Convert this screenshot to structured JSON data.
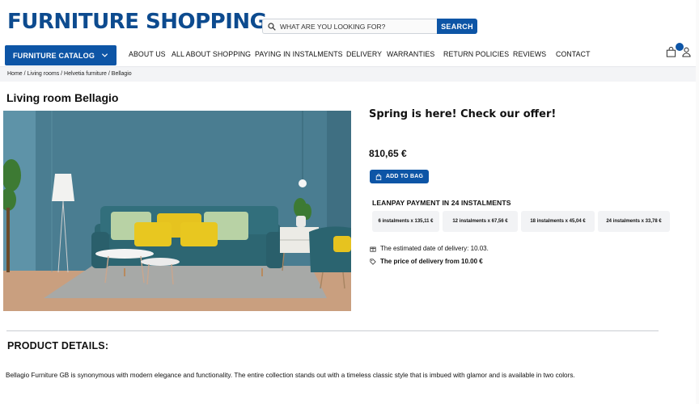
{
  "header": {
    "logo": "FURNITURE SHOPPING",
    "search_placeholder": "WHAT ARE YOU LOOKING FOR?",
    "search_button": "SEARCH"
  },
  "nav": {
    "catalog_label": "FURNITURE CATALOG",
    "items": [
      "ABOUT US",
      "ALL ABOUT SHOPPING",
      "PAYING IN INSTALMENTS",
      "DELIVERY",
      "WARRANTIES",
      "RETURN POLICIES",
      "REVIEWS",
      "CONTACT"
    ]
  },
  "breadcrumb": "Home / Living rooms / Helvetia furniture / Bellagio",
  "product": {
    "title": "Living room Bellagio",
    "promo": "Spring is here! Check our offer!",
    "price": "810,65 €",
    "add_to_bag": "ADD TO BAG",
    "leanpay_title": "LEANPAY PAYMENT IN 24 INSTALMENTS",
    "instalments": [
      "6 instalments x 135,11 €",
      "12 instalments x 67,56 €",
      "18 instalments x 45,04 €",
      "24 instalments x 33,78 €"
    ],
    "delivery_date": "The estimated date of delivery: 10.03.",
    "delivery_price": "The price of delivery from 10.00 €"
  },
  "details": {
    "title": "PRODUCT DETAILS:",
    "description": "Bellagio Furniture GB is synonymous with modern elegance and functionality. The entire collection stands out with a timeless classic style that is imbued with glamor and is available in two colors."
  },
  "colors": {
    "brand": "#0d4b8f",
    "button": "#0d55a6"
  },
  "icons": {
    "search": "search-icon",
    "chevron": "chevron-down-icon",
    "bag": "shopping-bag-icon",
    "user": "user-icon",
    "box": "box-icon",
    "tag": "tag-icon"
  }
}
